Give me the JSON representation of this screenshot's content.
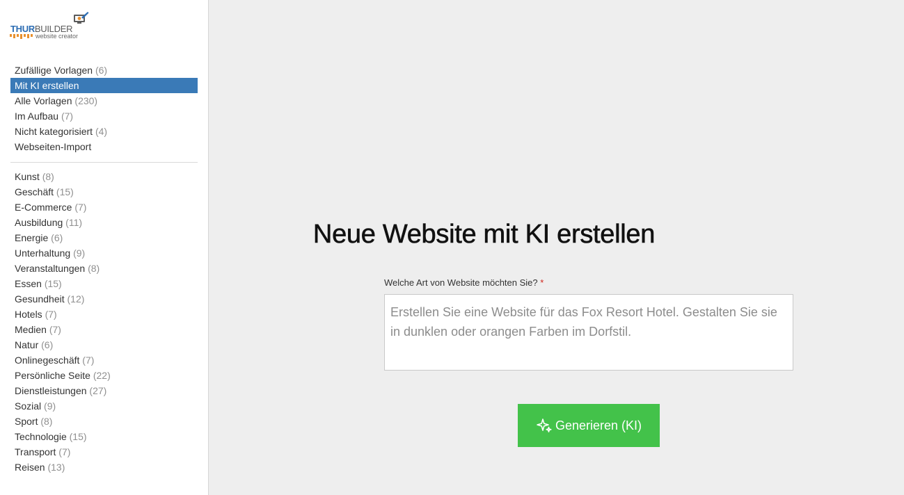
{
  "logo": {
    "brand_part1": "THUR",
    "brand_part2": "BUILDER",
    "subtitle": "website creator",
    "icon": "computer-brush-icon"
  },
  "nav_top": [
    {
      "label": "Zufällige Vorlagen",
      "count": "(6)"
    },
    {
      "label": "Mit KI erstellen",
      "count": "",
      "active": true
    },
    {
      "label": "Alle Vorlagen",
      "count": "(230)"
    },
    {
      "label": "Im Aufbau",
      "count": "(7)"
    },
    {
      "label": "Nicht kategorisiert",
      "count": "(4)"
    },
    {
      "label": "Webseiten-Import",
      "count": ""
    }
  ],
  "categories": [
    {
      "label": "Kunst",
      "count": "(8)"
    },
    {
      "label": "Geschäft",
      "count": "(15)"
    },
    {
      "label": "E-Commerce",
      "count": "(7)"
    },
    {
      "label": "Ausbildung",
      "count": "(11)"
    },
    {
      "label": "Energie",
      "count": "(6)"
    },
    {
      "label": "Unterhaltung",
      "count": "(9)"
    },
    {
      "label": "Veranstaltungen",
      "count": "(8)"
    },
    {
      "label": "Essen",
      "count": "(15)"
    },
    {
      "label": "Gesundheit",
      "count": "(12)"
    },
    {
      "label": "Hotels",
      "count": "(7)"
    },
    {
      "label": "Medien",
      "count": "(7)"
    },
    {
      "label": "Natur",
      "count": "(6)"
    },
    {
      "label": "Onlinegeschäft",
      "count": "(7)"
    },
    {
      "label": "Persönliche Seite",
      "count": "(22)"
    },
    {
      "label": "Dienstleistungen",
      "count": "(27)"
    },
    {
      "label": "Sozial",
      "count": "(9)"
    },
    {
      "label": "Sport",
      "count": "(8)"
    },
    {
      "label": "Technologie",
      "count": "(15)"
    },
    {
      "label": "Transport",
      "count": "(7)"
    },
    {
      "label": "Reisen",
      "count": "(13)"
    }
  ],
  "main": {
    "title": "Neue Website mit KI erstellen",
    "field_label": "Welche Art von Website möchten Sie?",
    "required_marker": "*",
    "textarea_placeholder": "Erstellen Sie eine Website für das Fox Resort Hotel. Gestalten Sie sie in dunklen oder orangen Farben im Dorfstil.",
    "textarea_value": "",
    "generate_label": "Generieren (KI)",
    "generate_icon": "sparkle-icon"
  },
  "colors": {
    "active_item": "#3a7ab7",
    "generate_button": "#43c24a",
    "required": "#d0261c",
    "logo_blue": "#2d6db3",
    "logo_orange": "#e8902e"
  }
}
